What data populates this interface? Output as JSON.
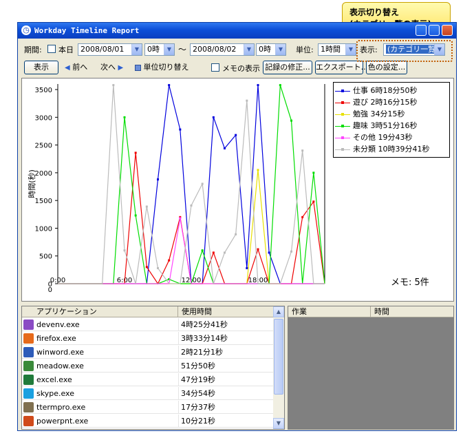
{
  "window": {
    "title": "Workday Timeline Report"
  },
  "callout": {
    "line1": "表示切り替え",
    "line2": "(カテゴリ一覧の表示)"
  },
  "toolbar": {
    "period_label": "期間:",
    "today_label": "本日",
    "start_date": "2008/08/01",
    "start_hour": "0時",
    "range_sep": "〜",
    "end_date": "2008/08/02",
    "end_hour": "0時",
    "unit_label": "単位:",
    "unit_value": "1時間",
    "display_label": "表示:",
    "display_value": "(カテゴリ一覧)",
    "show_button": "表示",
    "prev_button": "前へ",
    "next_button": "次へ",
    "unit_toggle_button": "単位切り替え",
    "memo_checkbox": "メモの表示",
    "edit_records_button": "記録の修正...",
    "export_button": "エクスポート...",
    "color_settings_button": "色の設定..."
  },
  "memo": "メモ: 5件",
  "chart_data": {
    "type": "line",
    "ylabel": "時間(秒)",
    "ylim": [
      0,
      3600
    ],
    "yticks": [
      0,
      500,
      1000,
      1500,
      2000,
      2500,
      3000,
      3500
    ],
    "xticks": [
      "0:00",
      "6:00",
      "12:00",
      "18:00"
    ],
    "x": [
      0,
      1,
      2,
      3,
      4,
      5,
      6,
      7,
      8,
      9,
      10,
      11,
      12,
      13,
      14,
      15,
      16,
      17,
      18,
      19,
      20,
      21,
      22,
      23,
      24
    ],
    "series": [
      {
        "name": "仕事 6時18分50秒",
        "color": "#0000dd",
        "values": [
          0,
          0,
          0,
          0,
          0,
          0,
          0,
          0,
          0,
          1880,
          3580,
          2780,
          0,
          0,
          3000,
          2440,
          2680,
          280,
          3580,
          560,
          0,
          0,
          0,
          0,
          0
        ]
      },
      {
        "name": "遊び 2時16分15秒",
        "color": "#ee0000",
        "values": [
          0,
          0,
          0,
          0,
          0,
          0,
          0,
          2360,
          300,
          0,
          420,
          1200,
          0,
          0,
          560,
          0,
          0,
          0,
          620,
          0,
          0,
          0,
          1200,
          1480,
          0
        ]
      },
      {
        "name": "勉強 34分15秒",
        "color": "#e8e000",
        "values": [
          0,
          0,
          0,
          0,
          0,
          0,
          0,
          0,
          0,
          0,
          0,
          0,
          0,
          0,
          0,
          0,
          0,
          0,
          2050,
          0,
          0,
          0,
          0,
          0,
          0
        ]
      },
      {
        "name": "趣味 3時51分16秒",
        "color": "#00dd00",
        "values": [
          0,
          0,
          0,
          0,
          0,
          0,
          3000,
          1230,
          0,
          0,
          80,
          0,
          0,
          600,
          0,
          0,
          0,
          0,
          0,
          0,
          3580,
          2940,
          0,
          2000,
          0
        ]
      },
      {
        "name": "その他 19分43秒",
        "color": "#ff44ff",
        "values": [
          0,
          0,
          0,
          0,
          0,
          0,
          0,
          0,
          0,
          0,
          0,
          1180,
          0,
          0,
          0,
          0,
          0,
          0,
          0,
          0,
          0,
          0,
          0,
          0,
          0
        ]
      },
      {
        "name": "未分類 10時39分41秒",
        "color": "#bbbbbb",
        "values": [
          0,
          0,
          0,
          0,
          0,
          3580,
          600,
          0,
          1390,
          280,
          0,
          0,
          1410,
          1800,
          0,
          560,
          890,
          3300,
          0,
          0,
          0,
          580,
          2400,
          0,
          0
        ]
      }
    ]
  },
  "applist": {
    "col_app": "アプリケーション",
    "col_time": "使用時間",
    "rows": [
      {
        "name": "devenv.exe",
        "time": "4時25分41秒",
        "icon_color": "#8a4bc4"
      },
      {
        "name": "firefox.exe",
        "time": "3時33分14秒",
        "icon_color": "#e66a1b"
      },
      {
        "name": "winword.exe",
        "time": "2時21分1秒",
        "icon_color": "#2d5bb9"
      },
      {
        "name": "meadow.exe",
        "time": "51分50秒",
        "icon_color": "#3a8a3a"
      },
      {
        "name": "excel.exe",
        "time": "47分19秒",
        "icon_color": "#1f7a3a"
      },
      {
        "name": "skype.exe",
        "time": "34分54秒",
        "icon_color": "#1aa0e0"
      },
      {
        "name": "ttermpro.exe",
        "time": "17分37秒",
        "icon_color": "#807050"
      },
      {
        "name": "powerpnt.exe",
        "time": "10分21秒",
        "icon_color": "#d04a1a"
      }
    ]
  },
  "taskpanel": {
    "col_task": "作業",
    "col_time": "時間"
  }
}
